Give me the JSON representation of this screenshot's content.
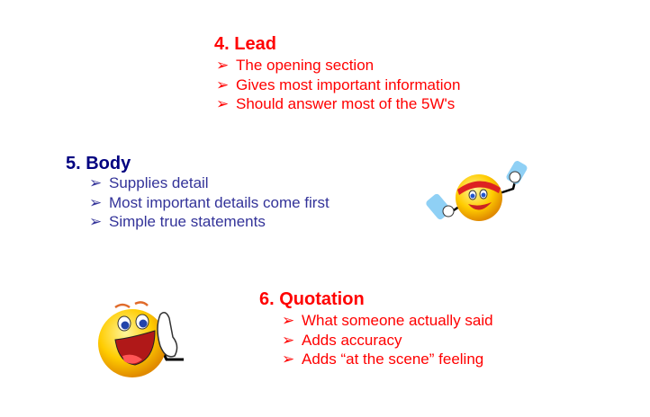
{
  "sections": [
    {
      "heading": "4. Lead",
      "bullets": [
        "The opening section",
        "Gives most important information",
        "Should answer most of the 5W's"
      ]
    },
    {
      "heading": "5. Body",
      "bullets": [
        "Supplies detail",
        "Most important details come first",
        "Simple true statements"
      ]
    },
    {
      "heading": "6. Quotation",
      "bullets": [
        "What someone actually said",
        "Adds accuracy",
        "Adds “at the scene” feeling"
      ]
    }
  ],
  "bullet_glyph": "➢",
  "colors": {
    "lead": "#ff0000",
    "body_heading": "#000080",
    "body_text": "#333399",
    "quotation": "#ff0000"
  }
}
